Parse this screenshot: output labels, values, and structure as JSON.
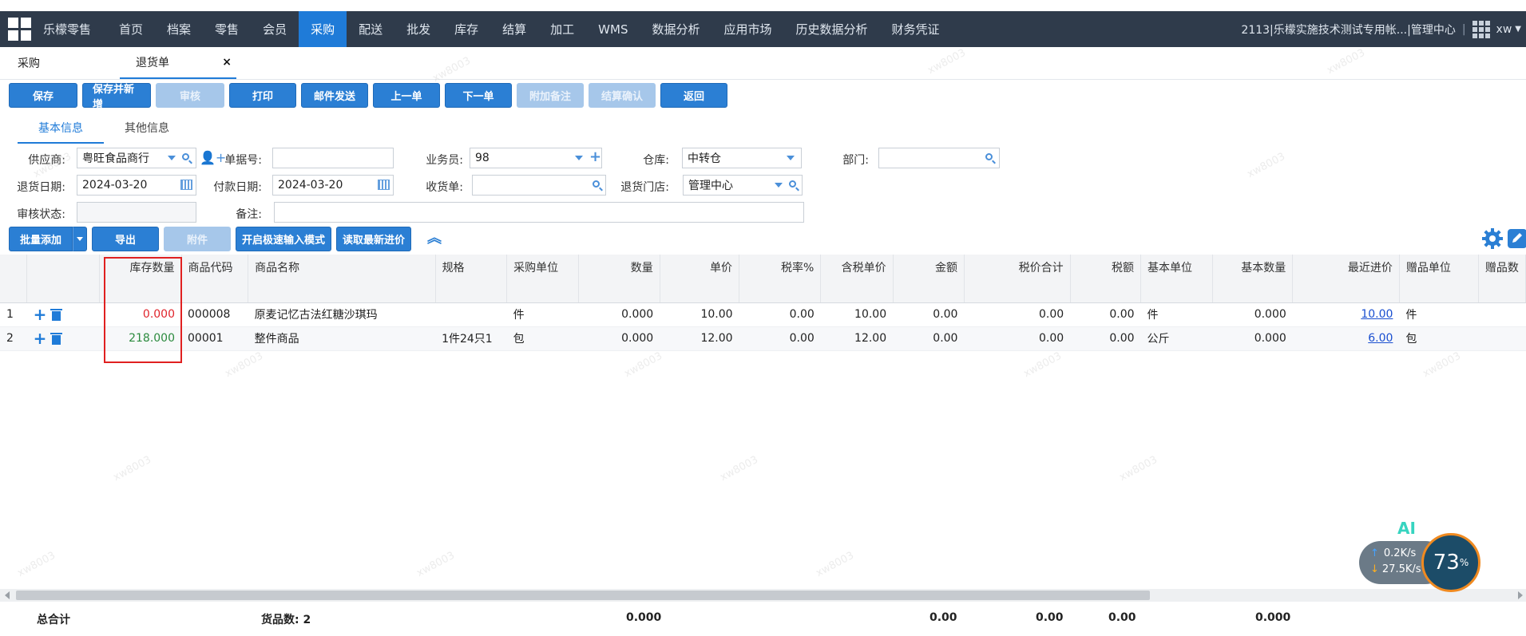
{
  "nav": {
    "brand": "乐檬零售",
    "items": [
      "首页",
      "档案",
      "零售",
      "会员",
      "采购",
      "配送",
      "批发",
      "库存",
      "结算",
      "加工",
      "WMS",
      "数据分析",
      "应用市场",
      "历史数据分析",
      "财务凭证"
    ],
    "active_index": 4,
    "account": "2113|乐檬实施技术测试专用帐...|管理中心",
    "separator": "|",
    "user": "xw"
  },
  "page_tabs": {
    "purchase": "采购",
    "return": "退货单",
    "close": "×"
  },
  "toolbar": [
    "保存",
    "保存并新增",
    "审核",
    "打印",
    "邮件发送",
    "上一单",
    "下一单",
    "附加备注",
    "结算确认",
    "返回"
  ],
  "sub_tabs": {
    "basic": "基本信息",
    "other": "其他信息"
  },
  "form": {
    "supplier_label": "供应商:",
    "supplier": "粤旺食品商行",
    "docno_label": "单据号:",
    "docno": "",
    "salesman_label": "业务员:",
    "salesman": "98",
    "warehouse_label": "仓库:",
    "warehouse": "中转仓",
    "dept_label": "部门:",
    "dept": "",
    "return_date_label": "退货日期:",
    "return_date": "2024-03-20",
    "pay_date_label": "付款日期:",
    "pay_date": "2024-03-20",
    "receipt_label": "收货单:",
    "receipt": "",
    "store_label": "退货门店:",
    "store": "管理中心",
    "audit_label": "审核状态:",
    "audit": "",
    "remark_label": "备注:",
    "remark": ""
  },
  "grid_toolbar": {
    "batch_add": "批量添加",
    "export": "导出",
    "attach": "附件",
    "fast_input": "开启极速输入模式",
    "latest_price": "读取最新进价"
  },
  "table": {
    "headers": [
      "库存数量",
      "商品代码",
      "商品名称",
      "规格",
      "采购单位",
      "数量",
      "单价",
      "税率%",
      "含税单价",
      "金额",
      "税价合计",
      "税额",
      "基本单位",
      "基本数量",
      "最近进价",
      "赠品单位",
      "赠品数"
    ],
    "rows": [
      {
        "no": "1",
        "stock": "0.000",
        "code": "000008",
        "name": "原麦记忆古法红糖沙琪玛",
        "spec": "",
        "unit": "件",
        "qty": "0.000",
        "price": "10.00",
        "tax_rate": "0.00",
        "tax_price": "10.00",
        "amount": "0.00",
        "total": "0.00",
        "tax": "0.00",
        "base_unit": "件",
        "base_qty": "0.000",
        "last_price": "10.00",
        "gift_unit": "件"
      },
      {
        "no": "2",
        "stock": "218.000",
        "code": "00001",
        "name": "整件商品",
        "spec": "1件24只1",
        "unit": "包",
        "qty": "0.000",
        "price": "12.00",
        "tax_rate": "0.00",
        "tax_price": "12.00",
        "amount": "0.00",
        "total": "0.00",
        "tax": "0.00",
        "base_unit": "公斤",
        "base_qty": "0.000",
        "last_price": "6.00",
        "gift_unit": "包"
      }
    ]
  },
  "footer": {
    "label": "总合计",
    "count": "货品数: 2",
    "qty": "0.000",
    "amount": "0.00",
    "total": "0.00",
    "tax": "0.00",
    "base_qty": "0.000"
  },
  "watermark": "xw8003",
  "net_widget": {
    "up_arrow": "↑",
    "up": "0.2K/s",
    "down_arrow": "↓",
    "down": "27.5K/s",
    "percent": "73",
    "percent_sign": "%",
    "ai": "AI"
  }
}
